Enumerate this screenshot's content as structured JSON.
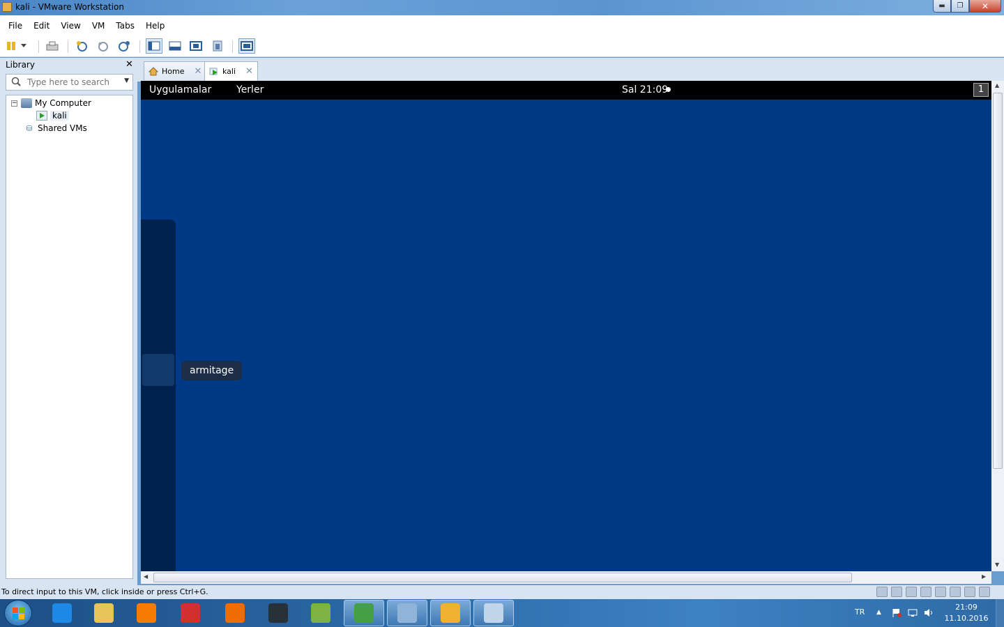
{
  "window": {
    "title": "kali - VMware Workstation",
    "controls": {
      "minimize": "▬",
      "maximize": "❐",
      "close": "✕"
    }
  },
  "menu": {
    "items": [
      "File",
      "Edit",
      "View",
      "VM",
      "Tabs",
      "Help"
    ]
  },
  "toolbar": {
    "icons": [
      "pause-icon",
      "dropdown-arrow-icon",
      "send-keys-icon",
      "snapshot-take-icon",
      "snapshot-revert-icon",
      "snapshot-manager-icon",
      "console-view-icon",
      "thumbnail-view-icon",
      "full-screen-icon",
      "unity-icon",
      "stretch-guest-icon"
    ]
  },
  "library": {
    "header": "Library",
    "close_label": "✕",
    "search_placeholder": "Type here to search",
    "tree": {
      "my_computer": "My Computer",
      "kali": "kali",
      "shared_vms": "Shared VMs"
    }
  },
  "tabs": [
    {
      "label": "Home",
      "icon": "home-icon",
      "active": false
    },
    {
      "label": "kali",
      "icon": "vm-running-icon",
      "active": true
    }
  ],
  "vm": {
    "panel": {
      "applications": "Uygulamalar",
      "places": "Yerler",
      "clock": "Sal 21:09"
    },
    "workspace_indicator": "1",
    "tooltip": "armitage",
    "background_color": "#003a87"
  },
  "status": {
    "hint": "To direct input to this VM, click inside or press Ctrl+G."
  },
  "taskbar": {
    "apps": [
      {
        "name": "internet-explorer",
        "color": "#1e88e5",
        "open": false
      },
      {
        "name": "file-explorer",
        "color": "#e8c35a",
        "open": false
      },
      {
        "name": "media-player",
        "color": "#f57c00",
        "open": false
      },
      {
        "name": "sketchup",
        "color": "#d32f2f",
        "open": false
      },
      {
        "name": "blender",
        "color": "#ef6c00",
        "open": false
      },
      {
        "name": "unity",
        "color": "#263238",
        "open": false
      },
      {
        "name": "android-studio",
        "color": "#7cb342",
        "open": false
      },
      {
        "name": "chrome",
        "color": "#43a047",
        "open": true
      },
      {
        "name": "notepad-app",
        "color": "#8fb4d8",
        "open": true
      },
      {
        "name": "vmware-workstation",
        "color": "#f0b030",
        "open": true
      },
      {
        "name": "paint",
        "color": "#c0d4ea",
        "open": true
      }
    ],
    "language": "TR",
    "clock_time": "21:09",
    "clock_date": "11.10.2016"
  }
}
